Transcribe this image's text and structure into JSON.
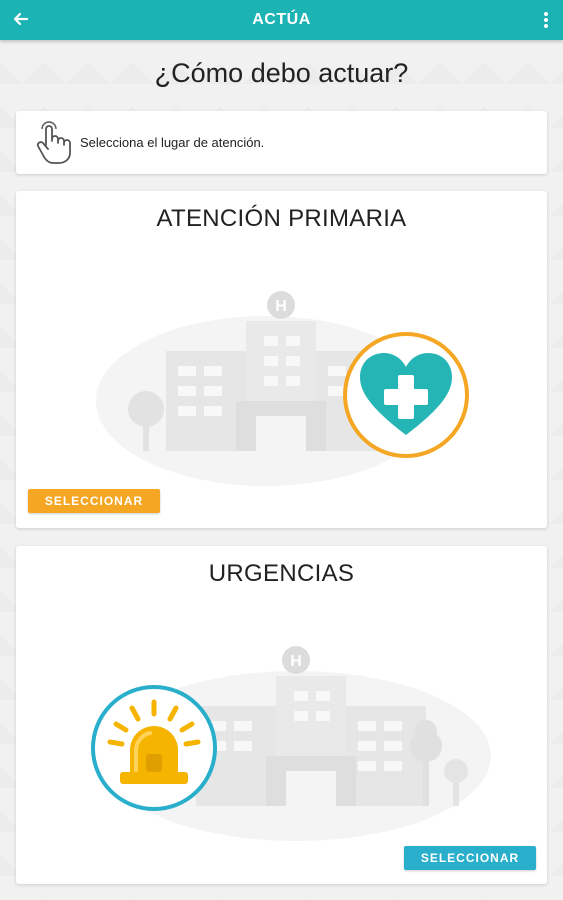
{
  "appbar": {
    "title": "ACTÚA",
    "back_icon": "arrow-back-icon",
    "menu_icon": "more-vertical-icon",
    "color": "#1bb3b3"
  },
  "page": {
    "heading": "¿Cómo debo actuar?"
  },
  "instruction": {
    "icon": "hand-pointer-icon",
    "text": "Selecciona el lugar de atención."
  },
  "options": [
    {
      "title": "ATENCIÓN PRIMARIA",
      "button_label": "SELECCIONAR",
      "button_color": "#f5a623",
      "icon": "heart-plus-icon",
      "icon_color": "#26b5b5",
      "ring_color": "#f5a623"
    },
    {
      "title": "URGENCIAS",
      "button_label": "SELECCIONAR",
      "button_color": "#29aecb",
      "icon": "siren-icon",
      "icon_color": "#f5b400",
      "ring_color": "#29aecb"
    }
  ]
}
